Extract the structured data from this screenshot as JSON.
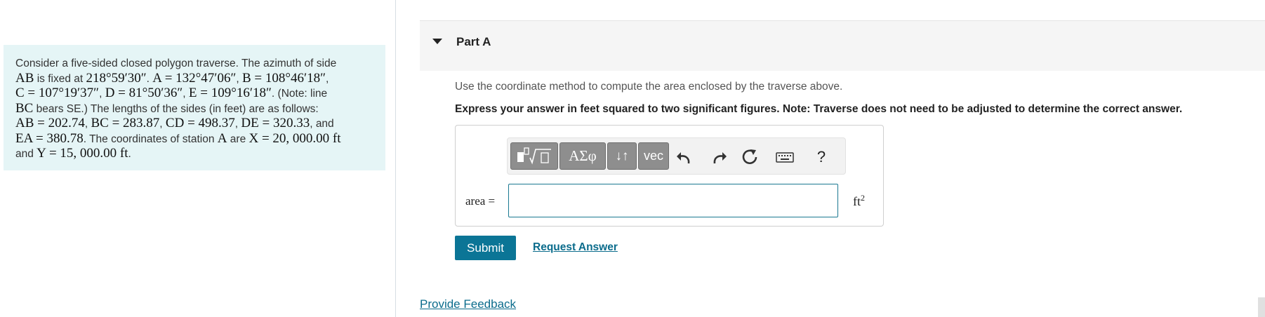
{
  "problem": {
    "lines": [
      [
        {
          "t": "Consider a five-sided closed polygon traverse. The azimuth of side",
          "m": false
        }
      ],
      [
        {
          "t": "AB",
          "m": true
        },
        {
          "t": " is fixed at ",
          "m": false
        },
        {
          "t": "218°59′30″",
          "m": true
        },
        {
          "t": ". ",
          "m": false
        },
        {
          "t": "A = 132°47′06″",
          "m": true
        },
        {
          "t": ", ",
          "m": false
        },
        {
          "t": "B = 108°46′18″",
          "m": true
        },
        {
          "t": ",",
          "m": false
        }
      ],
      [
        {
          "t": "C = 107°19′37″",
          "m": true
        },
        {
          "t": ", ",
          "m": false
        },
        {
          "t": "D = 81°50′36″",
          "m": true
        },
        {
          "t": ", ",
          "m": false
        },
        {
          "t": "E = 109°16′18″",
          "m": true
        },
        {
          "t": ". (Note: line",
          "m": false
        }
      ],
      [
        {
          "t": "BC",
          "m": true
        },
        {
          "t": " bears SE.) The lengths of the sides (in feet) are as follows:",
          "m": false
        }
      ],
      [
        {
          "t": "AB = 202.74",
          "m": true
        },
        {
          "t": ", ",
          "m": false
        },
        {
          "t": "BC = 283.87",
          "m": true
        },
        {
          "t": ", ",
          "m": false
        },
        {
          "t": "CD = 498.37",
          "m": true
        },
        {
          "t": ", ",
          "m": false
        },
        {
          "t": "DE = 320.33",
          "m": true
        },
        {
          "t": ", and",
          "m": false
        }
      ],
      [
        {
          "t": "EA = 380.78",
          "m": true
        },
        {
          "t": ". The coordinates of station ",
          "m": false
        },
        {
          "t": "A",
          "m": true
        },
        {
          "t": " are ",
          "m": false
        },
        {
          "t": "X = 20, 000.00 ft",
          "m": true
        }
      ],
      [
        {
          "t": "and ",
          "m": false
        },
        {
          "t": "Y = 15, 000.00 ft",
          "m": true
        },
        {
          "t": ".",
          "m": false
        }
      ]
    ]
  },
  "part": {
    "title": "Part A"
  },
  "instruction": "Use the coordinate method to compute the area enclosed by the traverse above.",
  "express": "Express your answer in feet squared to two significant figures. Note: Traverse does not need to be adjusted to determine the correct answer.",
  "toolbar": {
    "templates_icon": "templates-icon",
    "greek_label": "ΑΣφ",
    "arrows_label": "↓↑",
    "vec_label": "vec",
    "undo_icon": "undo-icon",
    "redo_icon": "redo-icon",
    "reset_icon": "reset-icon",
    "keyboard_icon": "keyboard-icon",
    "help_label": "?"
  },
  "answer": {
    "label": "area =",
    "value": "",
    "unit": "ft",
    "unit_exp": "2"
  },
  "actions": {
    "submit": "Submit",
    "request": "Request Answer"
  },
  "feedback": "Provide Feedback",
  "colors": {
    "accent": "#0b7596",
    "problem_bg": "#e5f5f6",
    "toolbar_button": "#8e8e8e"
  }
}
